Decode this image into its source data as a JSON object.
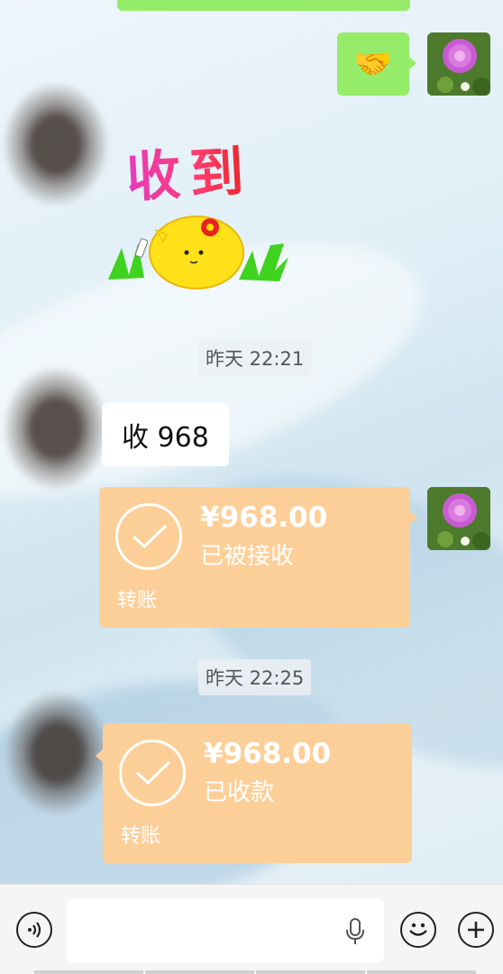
{
  "messages": {
    "sent_emoji": "🤝",
    "sticker_text": "收到",
    "time_1": "昨天 22:21",
    "received_text": "收 968",
    "transfer_sent": {
      "amount": "¥968.00",
      "status": "已被接收",
      "label": "转账"
    },
    "time_2": "昨天 22:25",
    "transfer_received": {
      "amount": "¥968.00",
      "status": "已收款",
      "label": "转账"
    }
  },
  "input_bar": {
    "voice_icon": "voice-icon",
    "mic_icon": "microphone-icon",
    "emoji_icon": "emoji-icon",
    "plus_icon": "plus-icon"
  },
  "colors": {
    "sent_bubble": "#95ec69",
    "transfer_card": "#fdcf98",
    "received_bubble": "#ffffff"
  }
}
